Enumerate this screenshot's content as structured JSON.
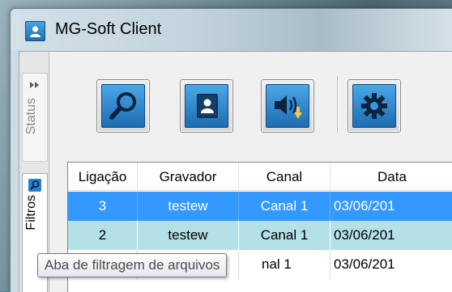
{
  "window": {
    "title": "MG-Soft Client",
    "app_icon": "user-portrait-icon"
  },
  "tabs": [
    {
      "label": "Status",
      "icon": "double-chevron-right-icon",
      "active": false
    },
    {
      "label": "Filtros",
      "icon": "search-icon",
      "active": true
    }
  ],
  "toolbar": {
    "buttons": [
      {
        "icon": "search-icon"
      },
      {
        "icon": "contact-card-icon"
      },
      {
        "icon": "speaker-download-icon"
      },
      {
        "icon": "gear-icon"
      }
    ]
  },
  "grid": {
    "columns": [
      "Ligação",
      "Gravador",
      "Canal",
      "Data"
    ],
    "rows": [
      {
        "ligacao": "3",
        "gravador": "testew",
        "canal": "Canal 1",
        "data": "03/06/201"
      },
      {
        "ligacao": "2",
        "gravador": "testew",
        "canal": "Canal 1",
        "data": "03/06/201"
      },
      {
        "ligacao": "",
        "gravador": "",
        "canal": "nal 1",
        "data": "03/06/201"
      }
    ]
  },
  "tooltip": {
    "text": "Aba de filtragem de arquivos"
  },
  "colors": {
    "selection": "#3399ff",
    "alt_row": "#b4e0e7",
    "button_blue": "#1e6bb2"
  }
}
